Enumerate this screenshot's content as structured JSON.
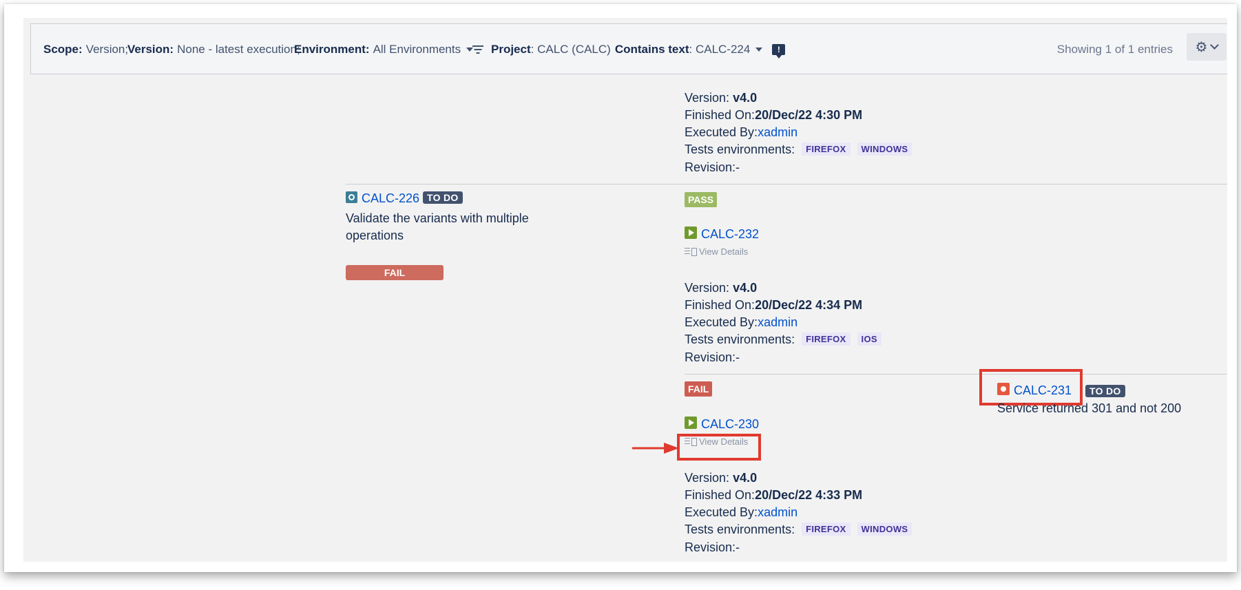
{
  "toolbar": {
    "scope_label": "Scope:",
    "scope_value": "Version;",
    "version_label": "Version:",
    "version_value": "None - latest execution;",
    "environment_label": "Environment:",
    "environment_value": "All Environments",
    "project_label": "Project",
    "project_value": ": CALC (CALC)",
    "contains_label": "Contains text",
    "contains_value": ": CALC-224",
    "message_glyph": "!",
    "showing_text": "Showing 1 of 1 entries",
    "gear_glyph": "⚙"
  },
  "labels": {
    "version": "Version:",
    "finished_on": "Finished On:",
    "executed_by": "Executed By:",
    "tests_environments": "Tests environments:",
    "revision": "Revision:-",
    "view_details": "View Details"
  },
  "exec_top": {
    "version": "v4.0",
    "finished_on": "20/Dec/22 4:30 PM",
    "executed_by": "xadmin",
    "envs": [
      "FIREFOX",
      "WINDOWS"
    ]
  },
  "test": {
    "key": "CALC-226",
    "status": "TO DO",
    "summary": "Validate the variants with multiple operations",
    "result": "FAIL"
  },
  "exec_232": {
    "status": "PASS",
    "key": "CALC-232",
    "version": "v4.0",
    "finished_on": "20/Dec/22 4:34 PM",
    "executed_by": "xadmin",
    "envs": [
      "FIREFOX",
      "IOS"
    ]
  },
  "exec_230": {
    "status": "FAIL",
    "key": "CALC-230",
    "version": "v4.0",
    "finished_on": "20/Dec/22 4:33 PM",
    "executed_by": "xadmin",
    "envs": [
      "FIREFOX",
      "WINDOWS"
    ]
  },
  "defect": {
    "key": "CALC-231",
    "status": "TO DO",
    "summary": "Service returned 301 and not 200"
  },
  "colors": {
    "link": "#0052cc",
    "pass": "#9bba63",
    "fail": "#cd5c52",
    "highlight": "#e03a2f"
  }
}
